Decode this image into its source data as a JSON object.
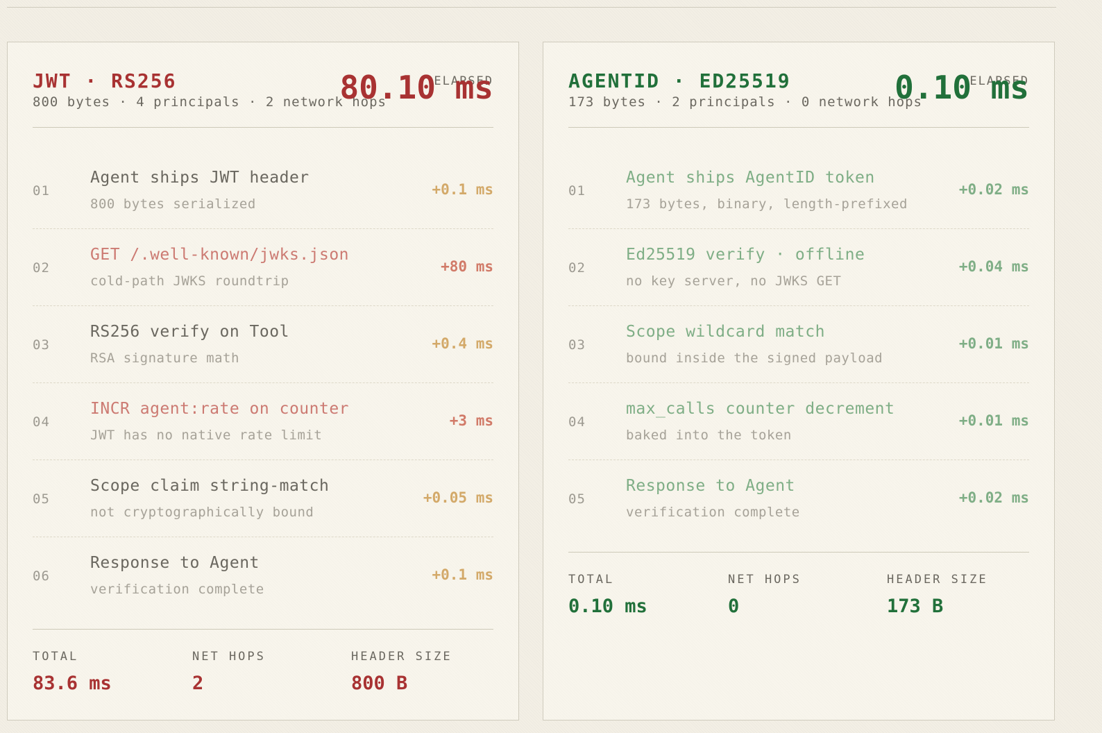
{
  "jwt": {
    "title": "JWT · RS256",
    "subtitle": "800 bytes · 4 principals · 2 network hops",
    "elapsed_value": "80.10 ms",
    "elapsed_label": "ELAPSED",
    "steps": [
      {
        "num": "01",
        "label": "Agent ships JWT header",
        "desc": "800 bytes serialized",
        "delta": "+0.1 ms"
      },
      {
        "num": "02",
        "label": "GET /.well-known/jwks.json",
        "desc": "cold-path JWKS roundtrip",
        "delta": "+80 ms"
      },
      {
        "num": "03",
        "label": "RS256 verify on Tool",
        "desc": "RSA signature math",
        "delta": "+0.4 ms"
      },
      {
        "num": "04",
        "label": "INCR agent:rate on counter",
        "desc": "JWT has no native rate limit",
        "delta": "+3 ms"
      },
      {
        "num": "05",
        "label": "Scope claim string-match",
        "desc": "not cryptographically bound",
        "delta": "+0.05 ms"
      },
      {
        "num": "06",
        "label": "Response to Agent",
        "desc": "verification complete",
        "delta": "+0.1 ms"
      }
    ],
    "summary": {
      "total_label": "TOTAL",
      "total_value": "83.6 ms",
      "hops_label": "NET HOPS",
      "hops_value": "2",
      "size_label": "HEADER SIZE",
      "size_value": "800 B"
    }
  },
  "agentid": {
    "title": "AGENTID · ED25519",
    "subtitle": "173 bytes · 2 principals · 0 network hops",
    "elapsed_value": "0.10 ms",
    "elapsed_label": "ELAPSED",
    "steps": [
      {
        "num": "01",
        "label": "Agent ships AgentID token",
        "desc": "173 bytes, binary, length-prefixed",
        "delta": "+0.02 ms"
      },
      {
        "num": "02",
        "label": "Ed25519 verify · offline",
        "desc": "no key server, no JWKS GET",
        "delta": "+0.04 ms"
      },
      {
        "num": "03",
        "label": "Scope wildcard match",
        "desc": "bound inside the signed payload",
        "delta": "+0.01 ms"
      },
      {
        "num": "04",
        "label": "max_calls counter decrement",
        "desc": "baked into the token",
        "delta": "+0.01 ms"
      },
      {
        "num": "05",
        "label": "Response to Agent",
        "desc": "verification complete",
        "delta": "+0.02 ms"
      }
    ],
    "summary": {
      "total_label": "TOTAL",
      "total_value": "0.10 ms",
      "hops_label": "NET HOPS",
      "hops_value": "0",
      "size_label": "HEADER SIZE",
      "size_value": "173 B"
    }
  },
  "colors": {
    "jwt_accent": "#a83232",
    "agentid_accent": "#21703a",
    "slow_step": "#cc7a72",
    "fast_step": "#7fae86",
    "delta_amber": "#d3a969"
  }
}
